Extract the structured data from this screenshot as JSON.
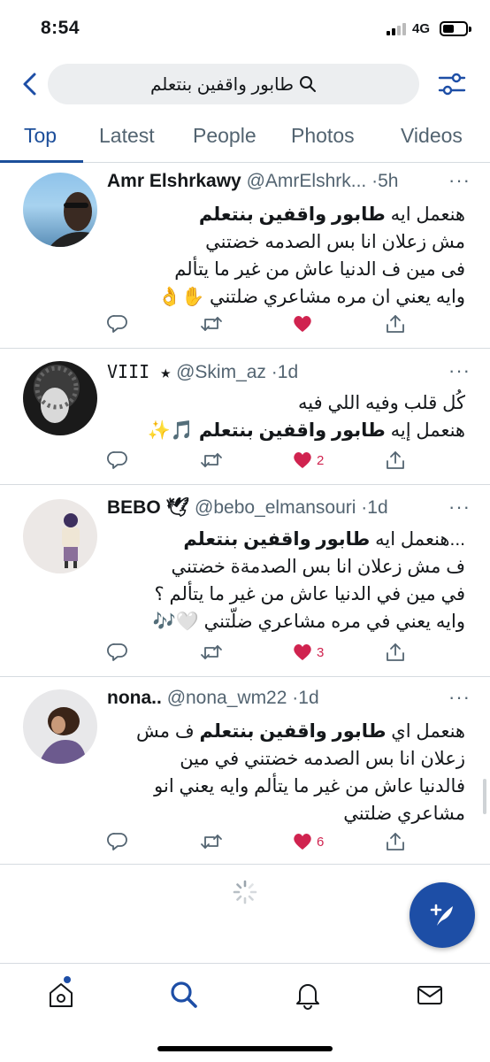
{
  "status_bar": {
    "time": "8:54",
    "network": "4G"
  },
  "search": {
    "query": "طابور واقفين بنتعلم"
  },
  "tabs": [
    {
      "label": "Top",
      "active": true
    },
    {
      "label": "Latest",
      "active": false
    },
    {
      "label": "People",
      "active": false
    },
    {
      "label": "Photos",
      "active": false
    },
    {
      "label": "Videos",
      "active": false
    }
  ],
  "tweets": [
    {
      "name": "Amr Elshrkawy",
      "handle": "@AmrElshrk...",
      "time": "·5h",
      "lines": [
        {
          "pre": "هنعمل ايه ",
          "bold": "طابور واقفين بنتعلم",
          "post": ""
        },
        {
          "pre": "مش زعلان انا بس الصدمه خضتني",
          "bold": "",
          "post": ""
        },
        {
          "pre": "فى مين ف الدنيا عاش من غير ما يتألم",
          "bold": "",
          "post": ""
        },
        {
          "pre": "وايه يعني ان مره مشاعري ضلتني ✋👌",
          "bold": "",
          "post": ""
        }
      ],
      "likes": ""
    },
    {
      "name": "VIII ★",
      "handle": "@Skim_az",
      "time": "·1d",
      "lines": [
        {
          "pre": "كُل قلب وفيه اللي فيه",
          "bold": "",
          "post": ""
        },
        {
          "pre": "هنعمل إيه ",
          "bold": "طابور واقفين بنتعلم",
          "post": " 🎵✨"
        }
      ],
      "likes": "2"
    },
    {
      "name": "BEBO 🕊",
      "handle": "@bebo_elmansouri",
      "time": "·1d",
      "lines": [
        {
          "pre": "...هنعمل ايه ",
          "bold": "طابور واقفين بنتعلم",
          "post": ""
        },
        {
          "pre": "ف مش زعلان انا بس الصدمةة خضتني",
          "bold": "",
          "post": ""
        },
        {
          "pre": "في مين في الدنيا عاش من غير ما يتألم ؟",
          "bold": "",
          "post": ""
        },
        {
          "pre": "وايه يعني في مره مشاعري ضلّتني 🤍🎶",
          "bold": "",
          "post": ""
        }
      ],
      "likes": "3"
    },
    {
      "name": "nona..",
      "handle": "@nona_wm22",
      "time": "·1d",
      "lines": [
        {
          "pre": "هنعمل اي ",
          "bold": "طابور واقفين بنتعلم",
          "post": " ف مش"
        },
        {
          "pre": "زعلان انا بس الصدمه خضتني في مين",
          "bold": "",
          "post": ""
        },
        {
          "pre": "فالدنيا عاش من غير ما يتألم وايه يعني انو",
          "bold": "",
          "post": ""
        },
        {
          "pre": "مشاعري ضلتني",
          "bold": "",
          "post": ""
        }
      ],
      "likes": "6"
    }
  ],
  "colors": {
    "accent": "#1d4ea6",
    "like": "#d0234f",
    "muted": "#536471"
  }
}
